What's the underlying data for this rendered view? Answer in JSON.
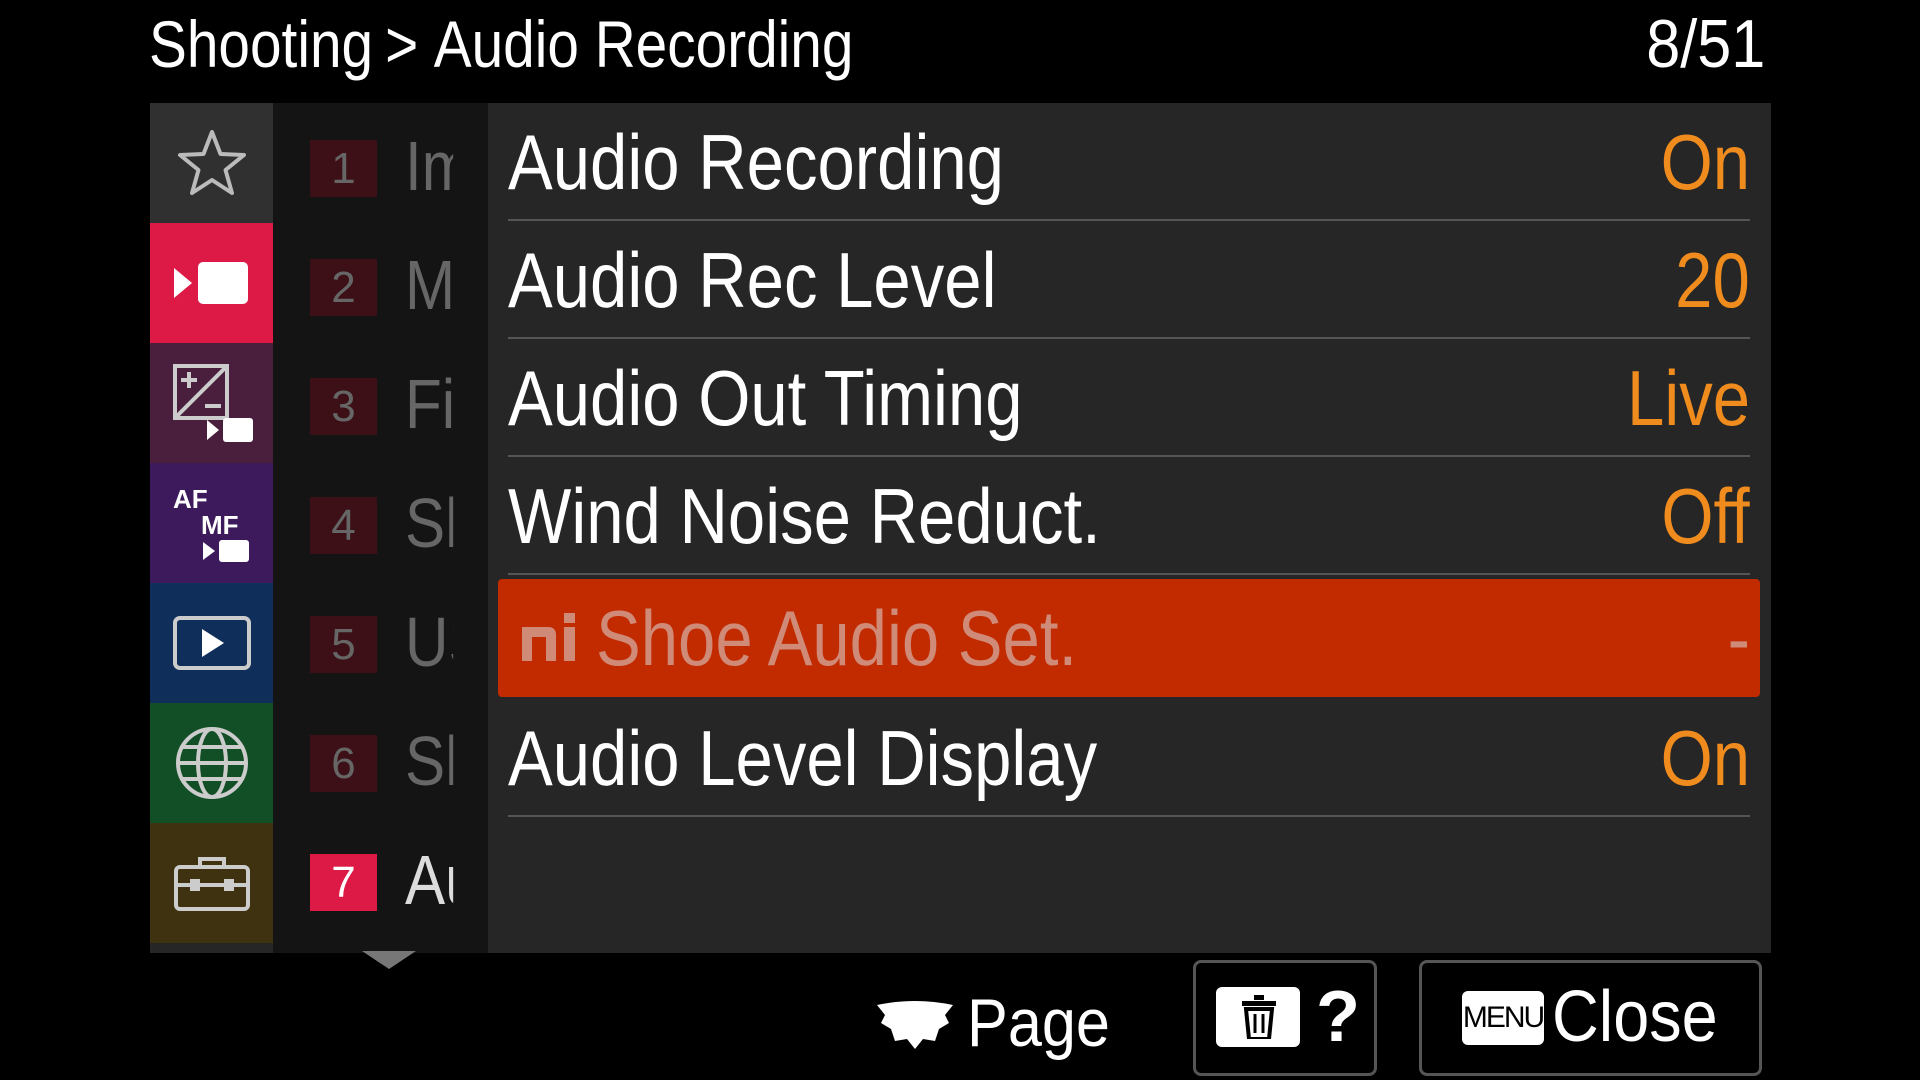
{
  "header": {
    "breadcrumb_parent": "Shooting",
    "breadcrumb_separator": ">",
    "breadcrumb_current": "Audio Recording",
    "page_counter": "8/51"
  },
  "category_tabs": [
    {
      "name": "my-menu",
      "icon": "star-icon",
      "color": "#303030",
      "active": false
    },
    {
      "name": "shooting",
      "icon": "movie-camera-icon",
      "color": "#dc1a45",
      "active": true
    },
    {
      "name": "exposure-color",
      "icon": "exposure-movie-icon",
      "color": "#4a1f3e",
      "active": false
    },
    {
      "name": "focus",
      "icon": "af-mf-icon",
      "color": "#3d1a5c",
      "active": false
    },
    {
      "name": "playback",
      "icon": "playback-icon",
      "color": "#0f2f5a",
      "active": false
    },
    {
      "name": "network",
      "icon": "globe-icon",
      "color": "#134f26",
      "active": false
    },
    {
      "name": "setup",
      "icon": "toolbox-icon",
      "color": "#3f3210",
      "active": false
    }
  ],
  "page_list": [
    {
      "number": "1",
      "abbr": "Im",
      "active": false
    },
    {
      "number": "2",
      "abbr": "M",
      "active": false
    },
    {
      "number": "3",
      "abbr": "Fi",
      "active": false
    },
    {
      "number": "4",
      "abbr": "Sh",
      "active": false
    },
    {
      "number": "5",
      "abbr": "US",
      "active": false
    },
    {
      "number": "6",
      "abbr": "Sh",
      "active": false
    },
    {
      "number": "7",
      "abbr": "Au",
      "active": true
    }
  ],
  "settings": [
    {
      "label": "Audio Recording",
      "value": "On",
      "selected": false
    },
    {
      "label": "Audio Rec Level",
      "value": "20",
      "selected": false
    },
    {
      "label": "Audio Out Timing",
      "value": "Live",
      "selected": false
    },
    {
      "label": "Wind Noise Reduct.",
      "value": "Off",
      "selected": false
    },
    {
      "label": "Shoe Audio Set.",
      "value": "-",
      "selected": true,
      "icon": "multi-interface-shoe-icon"
    },
    {
      "label": "Audio Level Display",
      "value": "On",
      "selected": false
    }
  ],
  "footer": {
    "page_hint_label": "Page",
    "help_label": "?",
    "menu_key_label": "MENU",
    "close_label": "Close"
  },
  "colors": {
    "value_orange": "#f08c1e",
    "selection_red": "#c22b00",
    "active_tab_red": "#dc1a45"
  }
}
